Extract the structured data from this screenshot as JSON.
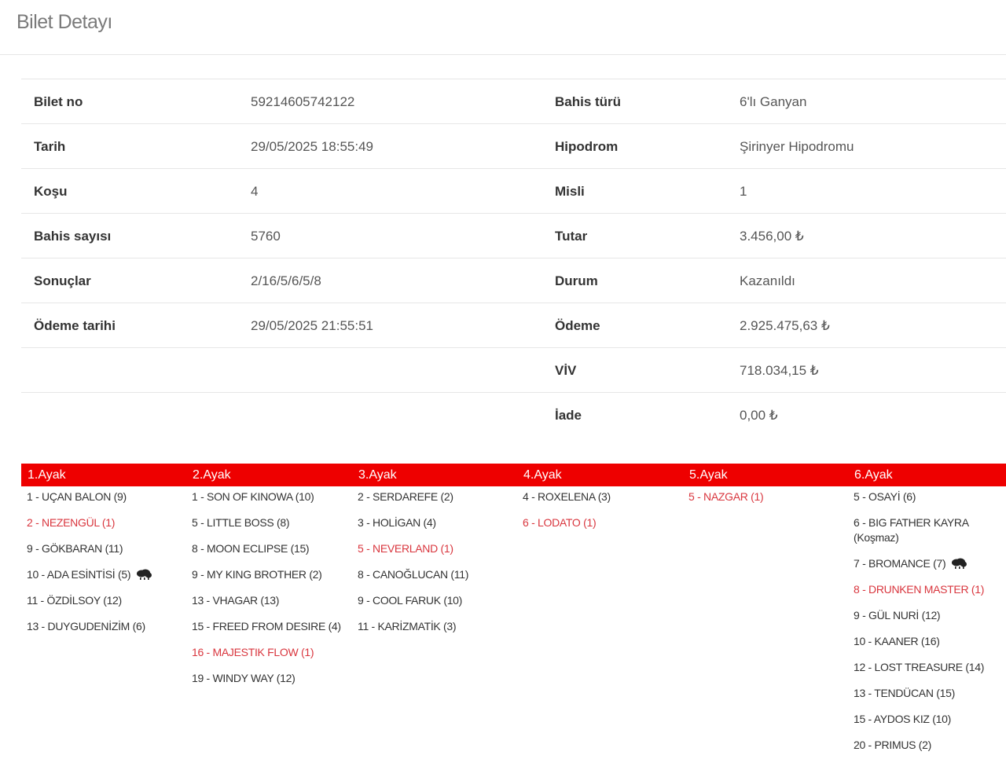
{
  "header": {
    "title": "Bilet Detayı"
  },
  "details": {
    "rows": [
      {
        "label_left": "Bilet no",
        "value_left": "59214605742122",
        "label_right": "Bahis türü",
        "value_right": "6'lı Ganyan"
      },
      {
        "label_left": "Tarih",
        "value_left": "29/05/2025 18:55:49",
        "label_right": "Hipodrom",
        "value_right": "Şirinyer Hipodromu"
      },
      {
        "label_left": "Koşu",
        "value_left": "4",
        "label_right": "Misli",
        "value_right": "1"
      },
      {
        "label_left": "Bahis sayısı",
        "value_left": "5760",
        "label_right": "Tutar",
        "value_right": "3.456,00 ₺"
      },
      {
        "label_left": "Sonuçlar",
        "value_left": "2/16/5/6/5/8",
        "label_right": "Durum",
        "value_right": "Kazanıldı"
      },
      {
        "label_left": "Ödeme tarihi",
        "value_left": "29/05/2025 21:55:51",
        "label_right": "Ödeme",
        "value_right": "2.925.475,63 ₺"
      },
      {
        "label_left": "",
        "value_left": "",
        "label_right": "VİV",
        "value_right": "718.034,15 ₺"
      },
      {
        "label_left": "",
        "value_left": "",
        "label_right": "İade",
        "value_right": "0,00 ₺"
      }
    ]
  },
  "legs": [
    {
      "title": "1.Ayak",
      "horses": [
        {
          "text": "1 - UÇAN BALON (9)",
          "winner": false
        },
        {
          "text": "2 - NEZENGÜL (1)",
          "winner": true
        },
        {
          "text": "9 - GÖKBARAN (11)",
          "winner": false
        },
        {
          "text": "10 - ADA ESİNTİSİ (5)",
          "winner": false,
          "icon": "rain-cloud-icon"
        },
        {
          "text": "11 - ÖZDİLSOY (12)",
          "winner": false
        },
        {
          "text": "13 - DUYGUDENİZİM (6)",
          "winner": false
        }
      ]
    },
    {
      "title": "2.Ayak",
      "horses": [
        {
          "text": "1 - SON OF KINOWA (10)",
          "winner": false
        },
        {
          "text": "5 - LITTLE BOSS (8)",
          "winner": false
        },
        {
          "text": "8 - MOON ECLIPSE (15)",
          "winner": false
        },
        {
          "text": "9 - MY KING BROTHER (2)",
          "winner": false
        },
        {
          "text": "13 - VHAGAR (13)",
          "winner": false
        },
        {
          "text": "15 - FREED FROM DESIRE (4)",
          "winner": false
        },
        {
          "text": "16 - MAJESTIK FLOW (1)",
          "winner": true
        },
        {
          "text": "19 - WINDY WAY (12)",
          "winner": false
        }
      ]
    },
    {
      "title": "3.Ayak",
      "horses": [
        {
          "text": "2 - SERDAREFE (2)",
          "winner": false
        },
        {
          "text": "3 - HOLİGAN (4)",
          "winner": false
        },
        {
          "text": "5 - NEVERLAND (1)",
          "winner": true
        },
        {
          "text": "8 - CANOĞLUCAN (11)",
          "winner": false
        },
        {
          "text": "9 - COOL FARUK (10)",
          "winner": false
        },
        {
          "text": "11 - KARİZMATİK (3)",
          "winner": false
        }
      ]
    },
    {
      "title": "4.Ayak",
      "horses": [
        {
          "text": "4 - ROXELENA (3)",
          "winner": false
        },
        {
          "text": "6 - LODATO (1)",
          "winner": true
        }
      ]
    },
    {
      "title": "5.Ayak",
      "horses": [
        {
          "text": "5 - NAZGAR (1)",
          "winner": true
        }
      ]
    },
    {
      "title": "6.Ayak",
      "horses": [
        {
          "text": "5 - OSAYİ (6)",
          "winner": false
        },
        {
          "text": "6 - BIG FATHER KAYRA (Koşmaz)",
          "winner": false
        },
        {
          "text": "7 - BROMANCE (7)",
          "winner": false,
          "icon": "rain-cloud-icon"
        },
        {
          "text": "8 - DRUNKEN MASTER (1)",
          "winner": true
        },
        {
          "text": "9 - GÜL NURİ (12)",
          "winner": false
        },
        {
          "text": "10 - KAANER (16)",
          "winner": false
        },
        {
          "text": "12 - LOST TREASURE (14)",
          "winner": false
        },
        {
          "text": "13 - TENDÜCAN (15)",
          "winner": false
        },
        {
          "text": "15 - AYDOS KIZ (10)",
          "winner": false
        },
        {
          "text": "20 - PRIMUS (2)",
          "winner": false
        }
      ]
    }
  ],
  "colors": {
    "accent_red": "#ee0000",
    "winner_text": "#d9363e"
  }
}
